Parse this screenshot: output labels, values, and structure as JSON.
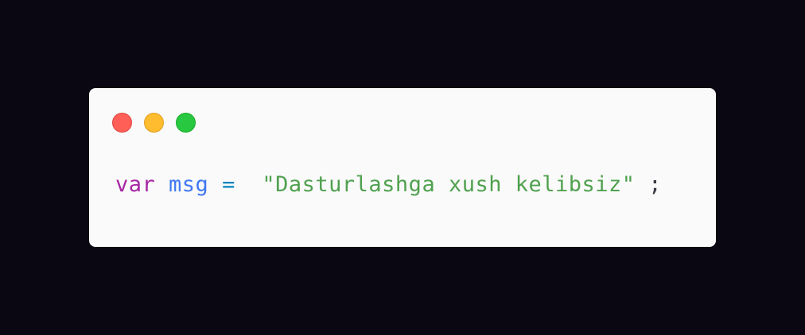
{
  "window_controls": [
    {
      "name": "close",
      "color": "#ff5f57"
    },
    {
      "name": "minimize",
      "color": "#febc2e"
    },
    {
      "name": "zoom",
      "color": "#28c840"
    }
  ],
  "code": {
    "keyword": "var",
    "identifier": "msg",
    "operator": "=",
    "string": "\"Dasturlashga xush kelibsiz\"",
    "terminator": ";"
  },
  "colors": {
    "background": "#0a0713",
    "card": "#fafafa",
    "keyword": "#a626a4",
    "identifier": "#4078f2",
    "operator": "#0184bc",
    "string": "#50a14f",
    "terminator": "#383a42"
  }
}
